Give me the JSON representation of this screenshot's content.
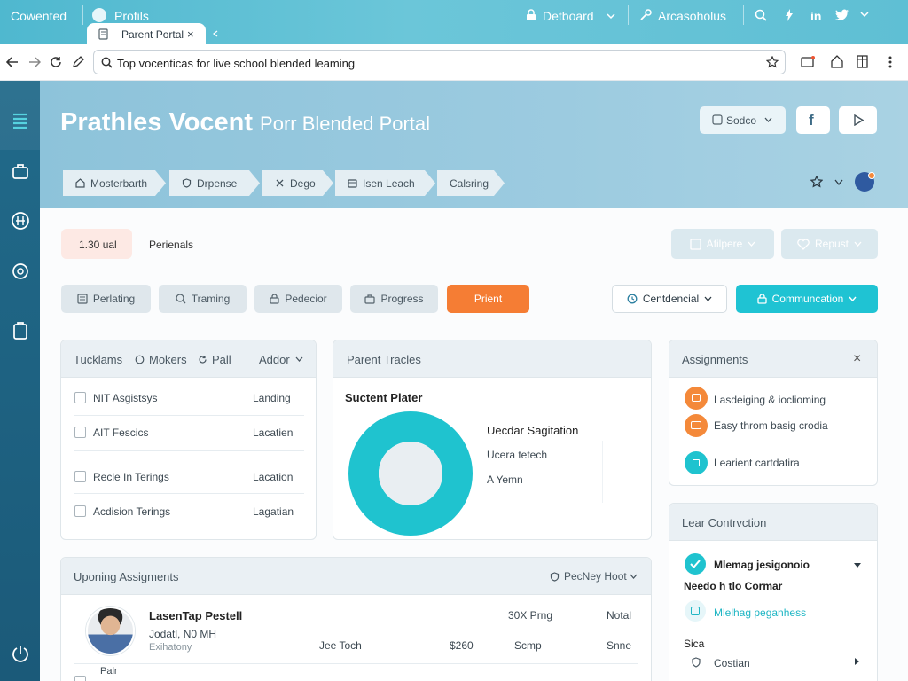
{
  "browser": {
    "app_name": "Cowented",
    "profile_label": "Profils",
    "dashboard_label": "Detboard",
    "account_label": "Arcasoholus",
    "linkedin_label": "in",
    "tab_title": "Parent Portal",
    "tab_close": "×",
    "url": "Top vocenticas for live school blended leaming"
  },
  "header": {
    "title_bold": "Prathles Vocent",
    "title_rest": "Porr Blended Portal",
    "select_label": "Sodco",
    "facebook_label": "f",
    "breadcrumbs": [
      "Mosterbarth",
      "Drpense",
      "Dego",
      "Isen Leach",
      "Calsring"
    ]
  },
  "summary": {
    "badge": "1.30 ual",
    "label": "Perienals",
    "action1": "Afilpere",
    "action2": "Repust"
  },
  "filters": {
    "buttons": [
      "Perlating",
      "Traming",
      "Pedecior",
      "Progress"
    ],
    "primary": "Prient",
    "select": "Centdencial",
    "cta": "Communcation"
  },
  "tasks_card": {
    "tabs": [
      "Tucklams",
      "Mokers",
      "Pall"
    ],
    "add_label": "Addor",
    "rows": [
      {
        "label": "NIT Asgistsys",
        "status": "Landing"
      },
      {
        "label": "AIT Fescics",
        "status": "Lacatien"
      },
      {
        "label": "Recle In Terings",
        "status": "Lacation"
      },
      {
        "label": "Acdision Terings",
        "status": "Lagatian"
      }
    ]
  },
  "tracker_card": {
    "title": "Parent Tracles",
    "subtitle": "Suctent Plater",
    "legend_title": "Uecdar Sagitation",
    "legend_items": [
      "Ucera tetech",
      "A Yemn"
    ],
    "chart_colors": {
      "ring": "#1fc3cf",
      "hole": "#e9eef2"
    }
  },
  "assign_card": {
    "title": "Assignments",
    "close": "×",
    "items": [
      {
        "label": "Lasdeiging & ioclioming",
        "color": "#f4893a"
      },
      {
        "label": "Easy throm basig crodia",
        "color": "#f4893a"
      },
      {
        "label": "Learient cartdatira",
        "color": "#1fc3cf"
      }
    ]
  },
  "upcoming_card": {
    "title": "Uponing Assigments",
    "filter": "PecNey Hoot",
    "row": {
      "name": "LasenTap Pestell",
      "detail1": "Jodatl, N0 MH",
      "detail2": "Exihatony",
      "c1": "Jee Toch",
      "c2": "$260",
      "c3": "30X Prng",
      "c4": "Scmp",
      "c5": "Notal",
      "c6": "Snne"
    },
    "next_label": "Palr"
  },
  "contrib_card": {
    "title": "Lear Contrvction",
    "item_title": "Mlemag jesigonoio",
    "subtitle": "Needo h tlo Cormar",
    "link": "Mlelhag peganhess",
    "section": "Sica",
    "last_item": "Costian"
  }
}
